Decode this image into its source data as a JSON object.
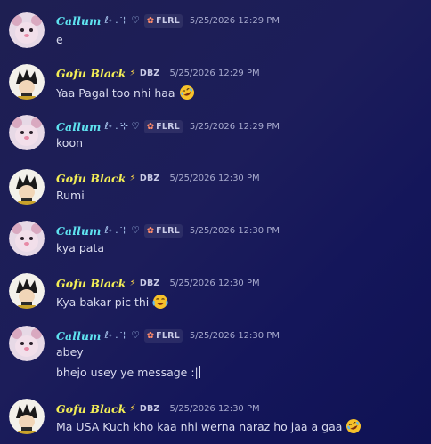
{
  "messages": [
    {
      "user": "Callum",
      "decor": "ℓ˖ . ݁⊹ ♡",
      "tag_icon": "fire-icon",
      "tag": "FLRL",
      "time": "5/25/2026 12:29 PM",
      "lines": [
        "e"
      ],
      "emoji": ""
    },
    {
      "user": "Gofu Black",
      "decor": "⚡",
      "tag_icon": "lightning-icon",
      "tag": "DBZ",
      "time": "5/25/2026 12:29 PM",
      "lines": [
        "Yaa Pagal too nhi haa"
      ],
      "emoji": "rofl-emoji"
    },
    {
      "user": "Callum",
      "decor": "ℓ˖ . ݁⊹ ♡",
      "tag_icon": "fire-icon",
      "tag": "FLRL",
      "time": "5/25/2026 12:29 PM",
      "lines": [
        "koon"
      ],
      "emoji": ""
    },
    {
      "user": "Gofu Black",
      "decor": "⚡",
      "tag_icon": "lightning-icon",
      "tag": "DBZ",
      "time": "5/25/2026 12:30 PM",
      "lines": [
        "Rumi"
      ],
      "emoji": ""
    },
    {
      "user": "Callum",
      "decor": "ℓ˖ . ݁⊹ ♡",
      "tag_icon": "fire-icon",
      "tag": "FLRL",
      "time": "5/25/2026 12:30 PM",
      "lines": [
        "kya pata"
      ],
      "emoji": ""
    },
    {
      "user": "Gofu Black",
      "decor": "⚡",
      "tag_icon": "lightning-icon",
      "tag": "DBZ",
      "time": "5/25/2026 12:30 PM",
      "lines": [
        "Kya bakar pic thi"
      ],
      "emoji": "joy-emoji"
    },
    {
      "user": "Callum",
      "decor": "ℓ˖ . ݁⊹ ♡",
      "tag_icon": "fire-icon",
      "tag": "FLRL",
      "time": "5/25/2026 12:30 PM",
      "lines": [
        "abey",
        "bhejo usey ye message :|"
      ],
      "emoji": ""
    },
    {
      "user": "Gofu Black",
      "decor": "⚡",
      "tag_icon": "lightning-icon",
      "tag": "DBZ",
      "time": "5/25/2026 12:30 PM",
      "lines": [
        "Ma USA Kuch kho kaa nhi werna naraz ho jaa a gaa"
      ],
      "emoji": "rofl-emoji"
    }
  ],
  "colors": {
    "callum_name": "#5fe3f0",
    "gofu_name": "#f3ee56",
    "message_text": "#d9dbef",
    "timestamp": "#a7aacd"
  }
}
